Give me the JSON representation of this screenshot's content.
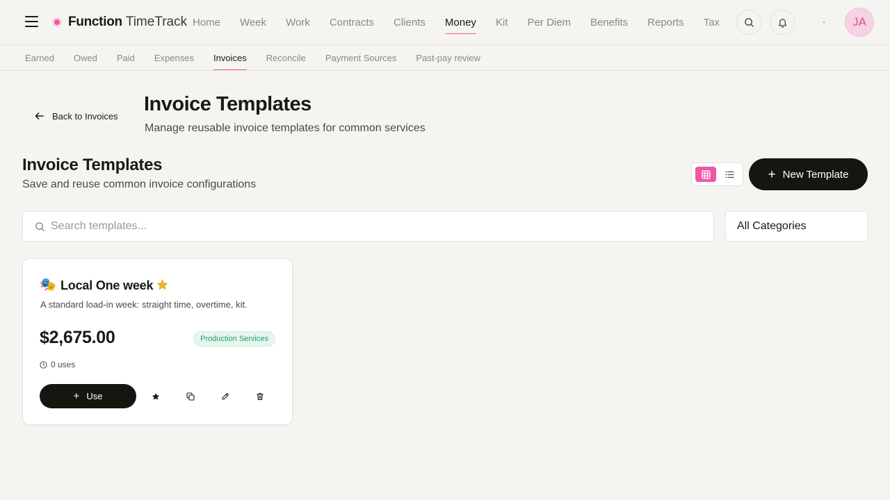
{
  "brand": {
    "name_bold": "Function",
    "name_light": "TimeTrack",
    "accent": "#f056a6"
  },
  "main_nav": [
    {
      "label": "Home",
      "active": false
    },
    {
      "label": "Week",
      "active": false
    },
    {
      "label": "Work",
      "active": false
    },
    {
      "label": "Contracts",
      "active": false
    },
    {
      "label": "Clients",
      "active": false
    },
    {
      "label": "Money",
      "active": true
    },
    {
      "label": "Kit",
      "active": false
    },
    {
      "label": "Per Diem",
      "active": false
    },
    {
      "label": "Benefits",
      "active": false
    },
    {
      "label": "Reports",
      "active": false
    },
    {
      "label": "Tax",
      "active": false
    }
  ],
  "user": {
    "initials": "JA"
  },
  "sub_nav": [
    {
      "label": "Earned",
      "active": false
    },
    {
      "label": "Owed",
      "active": false
    },
    {
      "label": "Paid",
      "active": false
    },
    {
      "label": "Expenses",
      "active": false
    },
    {
      "label": "Invoices",
      "active": true
    },
    {
      "label": "Reconcile",
      "active": false
    },
    {
      "label": "Payment Sources",
      "active": false
    },
    {
      "label": "Past-pay review",
      "active": false
    }
  ],
  "header": {
    "back_label": "Back to Invoices",
    "title": "Invoice Templates",
    "subtitle": "Manage reusable invoice templates for common services"
  },
  "section": {
    "title": "Invoice Templates",
    "subtitle": "Save and reuse common invoice configurations",
    "view_mode": "grid",
    "new_button_label": "New Template"
  },
  "search": {
    "placeholder": "Search templates...",
    "value": ""
  },
  "category_filter": {
    "selected": "All Categories"
  },
  "templates": [
    {
      "emoji": "🎭",
      "name": "Local One week",
      "favorite": true,
      "description": "A standard load-in week: straight time, overtime, kit.",
      "amount": "$2,675.00",
      "category": "Production Services",
      "uses": "0 uses",
      "use_label": "Use"
    }
  ],
  "colors": {
    "background": "#f5f4f1",
    "primary_button": "#17150f",
    "badge_text": "#1c9f62",
    "badge_bg": "#e6f5ee",
    "star": "#f0b429"
  }
}
